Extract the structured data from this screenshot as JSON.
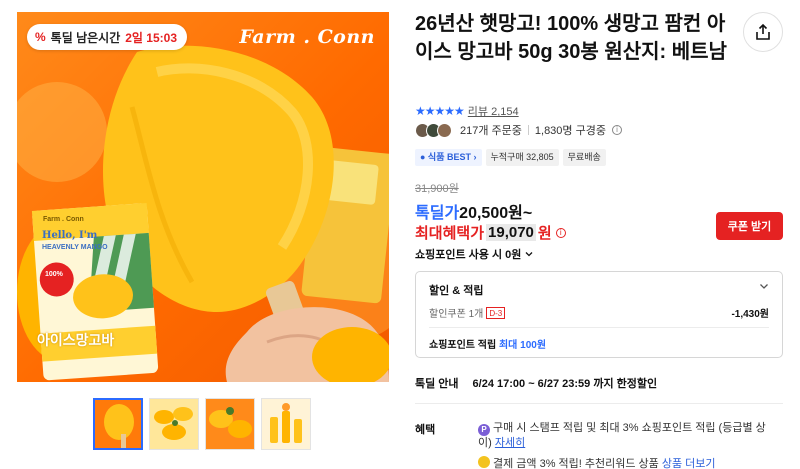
{
  "hero": {
    "deal_chip_icon": "%",
    "deal_chip_label": "톡딜 남은시간",
    "deal_chip_time": "2일 15:03",
    "brand_logo": "Farm . Conn",
    "package_brand": "Farm . Conn",
    "package_line1": "Hello, I'm",
    "package_line2": "HEAVENLY MANGO",
    "package_badge_top": "100%",
    "package_name": "아이스망고바"
  },
  "thumbnails": [
    {
      "name": "thumb-1",
      "active": true
    },
    {
      "name": "thumb-2",
      "active": false
    },
    {
      "name": "thumb-3",
      "active": false
    },
    {
      "name": "thumb-4",
      "active": false
    }
  ],
  "product": {
    "title": "26년산 햇망고! 100% 생망고 팜컨 아이스 망고바 50g 30봉 원산지: 베트남",
    "stars": "★★★★★",
    "review_label": "리뷰 2,154",
    "orders": "217개 주문중",
    "subscribers": "1,830명 구경중",
    "tag_best": "● 식품 BEST ›",
    "tag_sales": "누적구매 32,805",
    "tag_shipping": "무료배송"
  },
  "price": {
    "original": "31,900원",
    "deal_label": "톡딜가",
    "deal_value": "20,500원~",
    "max_label": "최대혜택가",
    "max_value": "19,070",
    "max_unit": "원",
    "coupon_button": "쿠폰 받기",
    "points_use": "쇼핑포인트 사용 시 0원"
  },
  "benefit_box": {
    "heading": "할인 & 적립",
    "coupon_label": "할인쿠폰 1개",
    "coupon_dday": "D-3",
    "coupon_amount": "-1,430원",
    "points_label": "쇼핑포인트 적립",
    "points_value": "최대 100원"
  },
  "deal_info": {
    "label": "톡딜 안내",
    "range": "6/24 17:00 ~ 6/27 23:59 까지 한정할인"
  },
  "perks": {
    "label": "혜택",
    "perk1_icon": "P",
    "perk1_text": "구매 시 스탬프 적립 및 최대 3% 쇼핑포인트 적립 (등급별 상이)",
    "perk1_more": "자세히",
    "perk2_text": "결제 금액 3% 적립! 추천리워드 상품",
    "perk2_more": "상품 더보기"
  },
  "colors": {
    "accent_blue": "#2b6bff",
    "accent_red": "#e52222",
    "mango_yellow": "#ffc21a",
    "bg_orange": "#ff7a0a"
  }
}
